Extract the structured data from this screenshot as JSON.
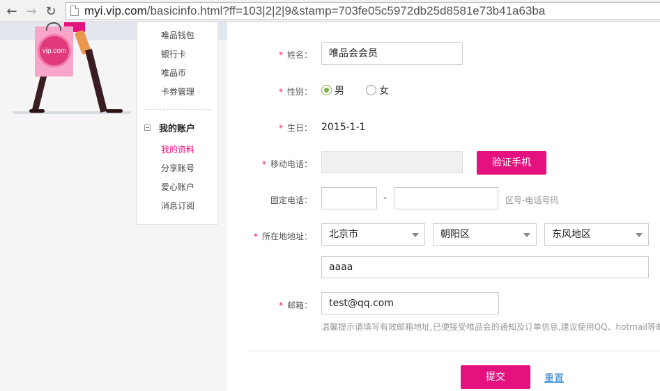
{
  "browser": {
    "url_host": "myi.vip.com",
    "url_rest": "/basicinfo.html?ff=103|2|2|9&stamp=703fe05c5972db25d8581e73b41a63ba"
  },
  "decoration": {
    "bag_logo": "vip.com"
  },
  "sidebar": {
    "items_top": [
      "唯品钱包",
      "银行卡",
      "唯品币",
      "卡券管理"
    ],
    "group_title": "我的账户",
    "group_items": [
      "我的资料",
      "分享账号",
      "爱心账户",
      "消息订阅"
    ],
    "active_item": "我的资料"
  },
  "form": {
    "required_mark": "*",
    "name": {
      "label": "姓名：",
      "value": "唯品会会员"
    },
    "gender": {
      "label": "性别：",
      "options": [
        "男",
        "女"
      ],
      "selected": "男"
    },
    "birthday": {
      "label": "生日：",
      "value": "2015-1-1"
    },
    "mobile": {
      "label": "移动电话：",
      "value": "",
      "verify_button": "验证手机"
    },
    "landline": {
      "label": "固定电话：",
      "separator": "-",
      "hint": "区号-电话号码"
    },
    "address": {
      "label": "所在地地址：",
      "province": "北京市",
      "city": "朝阳区",
      "district": "东风地区",
      "detail": "aaaa"
    },
    "email": {
      "label": "邮箱：",
      "value": "test@qq.com",
      "hint": "温馨提示请填写有效邮箱地址,已便接受唯品会的通知及订单信息,建议使用QQ、hotmail等邮"
    },
    "submit_label": "提交",
    "reset_label": "重置"
  },
  "colors": {
    "accent": "#e4117f",
    "radio_checked": "#7cb342",
    "link": "#2a7fc7"
  }
}
